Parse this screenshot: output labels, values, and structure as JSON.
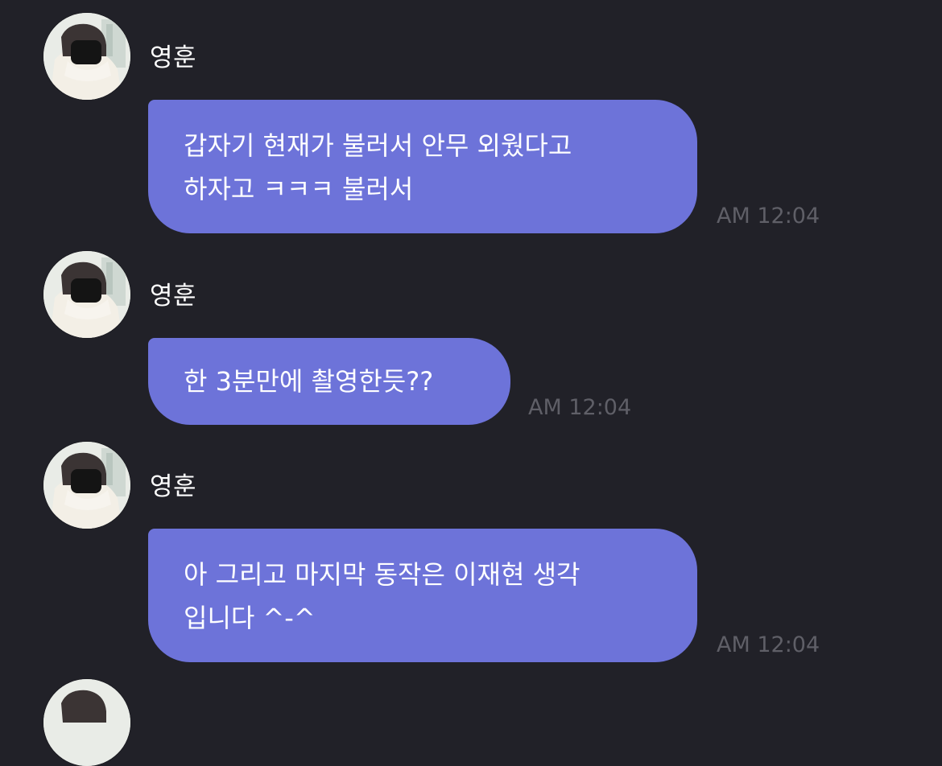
{
  "messages": [
    {
      "sender": "영훈",
      "lines": [
        "갑자기 현재가 불러서 안무 외웠다고",
        "하자고 ㅋㅋㅋ 불러서"
      ],
      "time": "AM 12:04"
    },
    {
      "sender": "영훈",
      "lines": [
        "한 3분만에 촬영한듯??"
      ],
      "time": "AM 12:04"
    },
    {
      "sender": "영훈",
      "lines": [
        "아 그리고 마지막 동작은 이재현 생각",
        "입니다 ^-^"
      ],
      "time": "AM 12:04"
    }
  ],
  "colors": {
    "background": "#212128",
    "bubble": "#6d73d9",
    "timestamp": "#5f5f67",
    "text": "#ffffff"
  },
  "icons": {
    "avatar": "profile-photo"
  }
}
